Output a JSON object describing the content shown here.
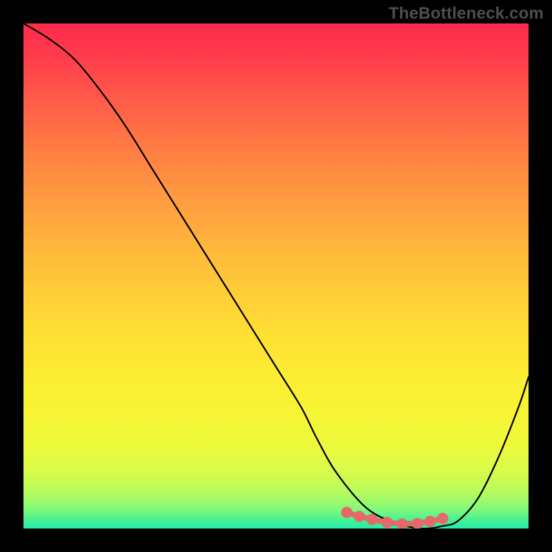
{
  "watermark": "TheBottleneck.com",
  "chart_data": {
    "type": "line",
    "title": "",
    "xlabel": "",
    "ylabel": "",
    "xlim": [
      0,
      100
    ],
    "ylim": [
      0,
      100
    ],
    "series": [
      {
        "name": "bottleneck-curve",
        "x": [
          0,
          5,
          10,
          15,
          20,
          25,
          30,
          35,
          40,
          45,
          50,
          55,
          58,
          62,
          68,
          74,
          79,
          83,
          86,
          90,
          94,
          98,
          100
        ],
        "y": [
          100,
          97,
          93,
          87,
          80,
          72,
          64,
          56,
          48,
          40,
          32,
          24,
          18,
          11,
          4,
          1,
          0,
          0.5,
          1.5,
          6,
          14,
          24,
          30
        ]
      }
    ],
    "highlight": {
      "name": "optimal-range",
      "color": "#e46a6a",
      "points_x": [
        64,
        66.5,
        69,
        72,
        75,
        78,
        80.5,
        83
      ],
      "points_y": [
        3.2,
        2.4,
        1.8,
        1.2,
        0.9,
        1.0,
        1.4,
        2.0
      ]
    },
    "gradient_stops": [
      {
        "pct": 0,
        "color": "#ff2b4e"
      },
      {
        "pct": 50,
        "color": "#ffd636"
      },
      {
        "pct": 85,
        "color": "#eefc3a"
      },
      {
        "pct": 100,
        "color": "#22eda8"
      }
    ]
  }
}
